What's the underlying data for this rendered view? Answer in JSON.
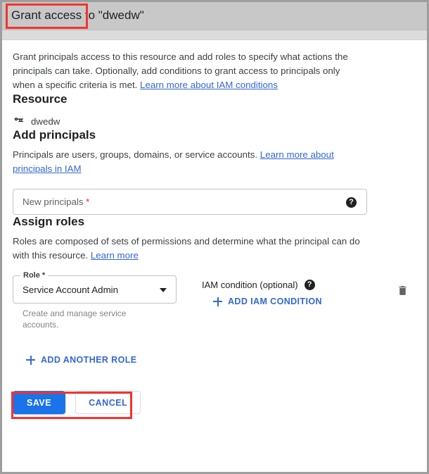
{
  "header": {
    "title": "Grant access to \"dwedw\""
  },
  "intro": {
    "text": "Grant principals access to this resource and add roles to specify what actions the principals can take. Optionally, add conditions to grant access to principals only when a specific criteria is met. ",
    "link": "Learn more about IAM conditions"
  },
  "resource": {
    "heading": "Resource",
    "icon": "key-icon",
    "name": "dwedw"
  },
  "principals": {
    "heading": "Add principals",
    "desc": "Principals are users, groups, domains, or service accounts. ",
    "link": "Learn more about principals in IAM",
    "field": {
      "placeholder": "New principals",
      "required_marker": "*",
      "value": "",
      "help_icon": "?"
    }
  },
  "roles": {
    "heading": "Assign roles",
    "desc": "Roles are composed of sets of permissions and determine what the principal can do with this resource. ",
    "link": "Learn more",
    "role_select": {
      "label": "Role *",
      "value": "Service Account Admin",
      "helper": "Create and manage service accounts."
    },
    "condition": {
      "label": "IAM condition (optional)",
      "help_icon": "?",
      "add_label": "ADD IAM CONDITION"
    },
    "delete_icon": "trash-icon",
    "add_another_role": "ADD ANOTHER ROLE"
  },
  "footer": {
    "save": "SAVE",
    "cancel": "CANCEL"
  },
  "colors": {
    "accent_blue": "#1a73e8",
    "link_blue": "#3367d6",
    "required_red": "#d93025",
    "annotation_red": "#f2342f",
    "titlebar_gray": "#c8c8c8",
    "frame_border": "#9e9e9e"
  }
}
